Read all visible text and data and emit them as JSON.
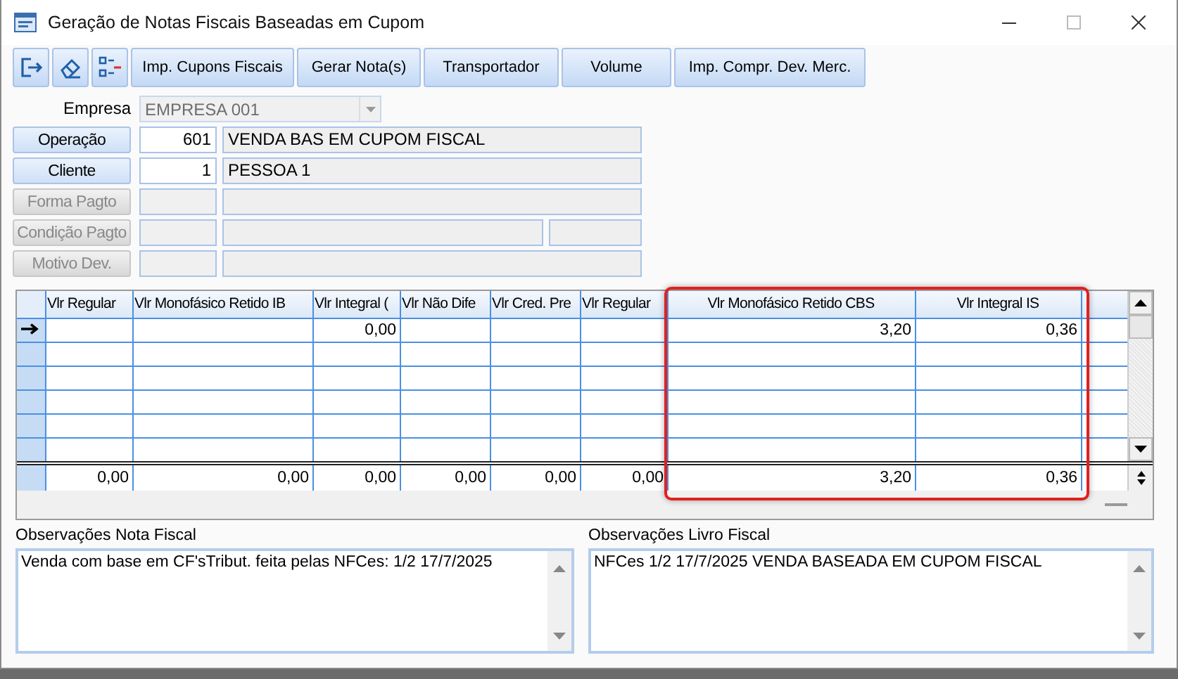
{
  "window": {
    "title": "Geração de Notas Fiscais Baseadas em Cupom"
  },
  "toolbar": [
    {
      "kind": "icon"
    },
    {
      "kind": "icon"
    },
    {
      "kind": "icon"
    },
    {
      "kind": "text",
      "label": "Imp. Cupons Fiscais"
    },
    {
      "kind": "text",
      "label": "Gerar Nota(s)"
    },
    {
      "kind": "text",
      "label": "Transportador"
    },
    {
      "kind": "text",
      "label": "Volume"
    },
    {
      "kind": "text",
      "label": "Imp. Compr. Dev. Merc."
    }
  ],
  "empresa": {
    "label": "Empresa",
    "value": "EMPRESA 001"
  },
  "fields": [
    {
      "button": "Operação",
      "disabled": false,
      "code": "601",
      "description": "VENDA BAS EM CUPOM FISCAL"
    },
    {
      "button": "Cliente",
      "disabled": false,
      "code": "1",
      "description": "PESSOA 1"
    },
    {
      "button": "Forma Pagto",
      "disabled": true
    },
    {
      "button": "Condição Pagto",
      "disabled": true,
      "extra_field": true
    },
    {
      "button": "Motivo Dev.",
      "disabled": true
    }
  ],
  "grid": {
    "columns": [
      {
        "label": "Vlr Regular",
        "highlighted": false
      },
      {
        "label": "Vlr Monofásico Retido IB",
        "highlighted": false
      },
      {
        "label": "Vlr Integral (",
        "highlighted": false
      },
      {
        "label": "Vlr Não Dife",
        "highlighted": false
      },
      {
        "label": "Vlr Cred. Pre",
        "highlighted": false
      },
      {
        "label": "Vlr Regular",
        "highlighted": false
      },
      {
        "label": "Vlr Monofásico Retido CBS",
        "highlighted": true
      },
      {
        "label": "Vlr Integral IS",
        "highlighted": true
      }
    ],
    "rows": [
      {
        "current": true,
        "cells": [
          "",
          "",
          "0,00",
          "",
          "",
          "",
          "3,20",
          "0,36"
        ]
      },
      {
        "current": false,
        "cells": [
          "",
          "",
          "",
          "",
          "",
          "",
          "",
          ""
        ]
      },
      {
        "current": false,
        "cells": [
          "",
          "",
          "",
          "",
          "",
          "",
          "",
          ""
        ]
      },
      {
        "current": false,
        "cells": [
          "",
          "",
          "",
          "",
          "",
          "",
          "",
          ""
        ]
      },
      {
        "current": false,
        "cells": [
          "",
          "",
          "",
          "",
          "",
          "",
          "",
          ""
        ]
      },
      {
        "current": false,
        "cells": [
          "",
          "",
          "",
          "",
          "",
          "",
          "",
          ""
        ]
      }
    ],
    "totals": [
      "0,00",
      "0,00",
      "0,00",
      "0,00",
      "0,00",
      "0,00",
      "3,20",
      "0,36"
    ]
  },
  "notes": [
    {
      "label": "Observações Nota Fiscal",
      "value": "Venda com base em CF'sTribut. feita pelas NFCes: 1/2 17/7/2025"
    },
    {
      "label": "Observações Livro Fiscal",
      "value": "NFCes 1/2 17/7/2025 VENDA BASEADA EM CUPOM FISCAL"
    }
  ]
}
